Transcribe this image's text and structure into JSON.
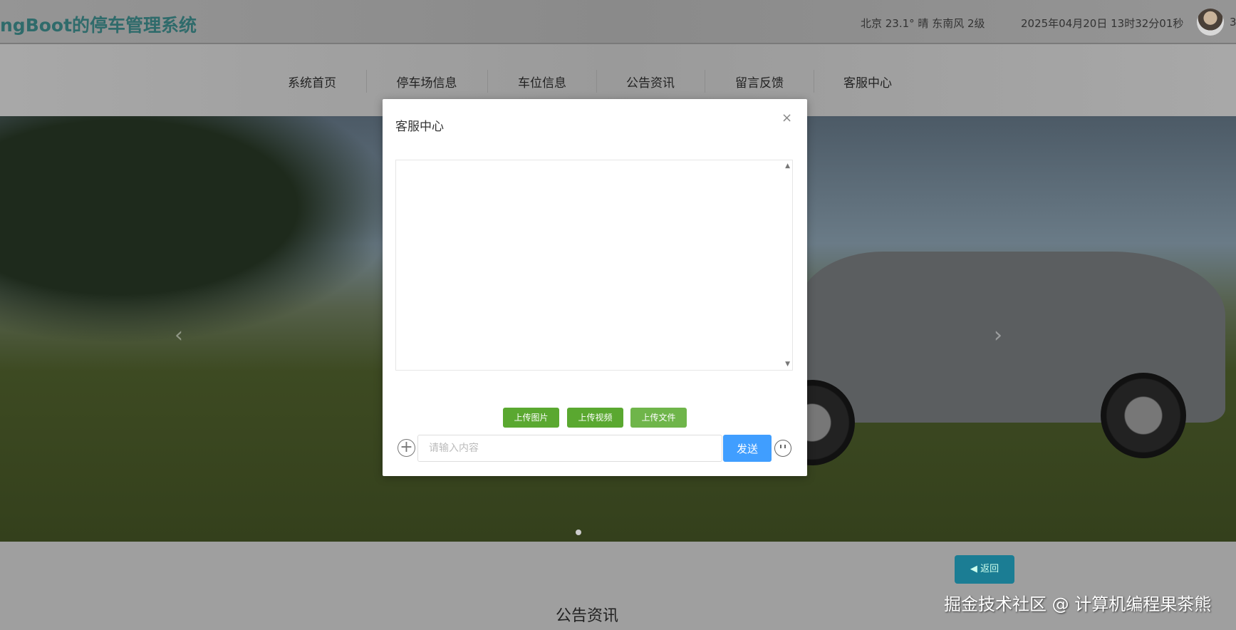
{
  "header": {
    "title": "ngBoot的停车管理系统",
    "weather": "北京  23.1°  晴  东南风  2级",
    "datetime": "2025年04月20日 13时32分01秒",
    "edge_char": "3"
  },
  "nav": {
    "items": [
      "系统首页",
      "停车场信息",
      "车位信息",
      "公告资讯",
      "留言反馈",
      "客服中心"
    ]
  },
  "banner": {
    "prev": "‹",
    "next": "›"
  },
  "bottom": {
    "back_label": "返回",
    "section_title": "公告资讯",
    "watermark": "掘金技术社区 @ 计算机编程果茶熊"
  },
  "modal": {
    "title": "客服中心",
    "close": "×",
    "upload_image": "上传图片",
    "upload_video": "上传视频",
    "upload_file": "上传文件",
    "input_placeholder": "请输入内容",
    "input_value": "",
    "send": "发送"
  }
}
